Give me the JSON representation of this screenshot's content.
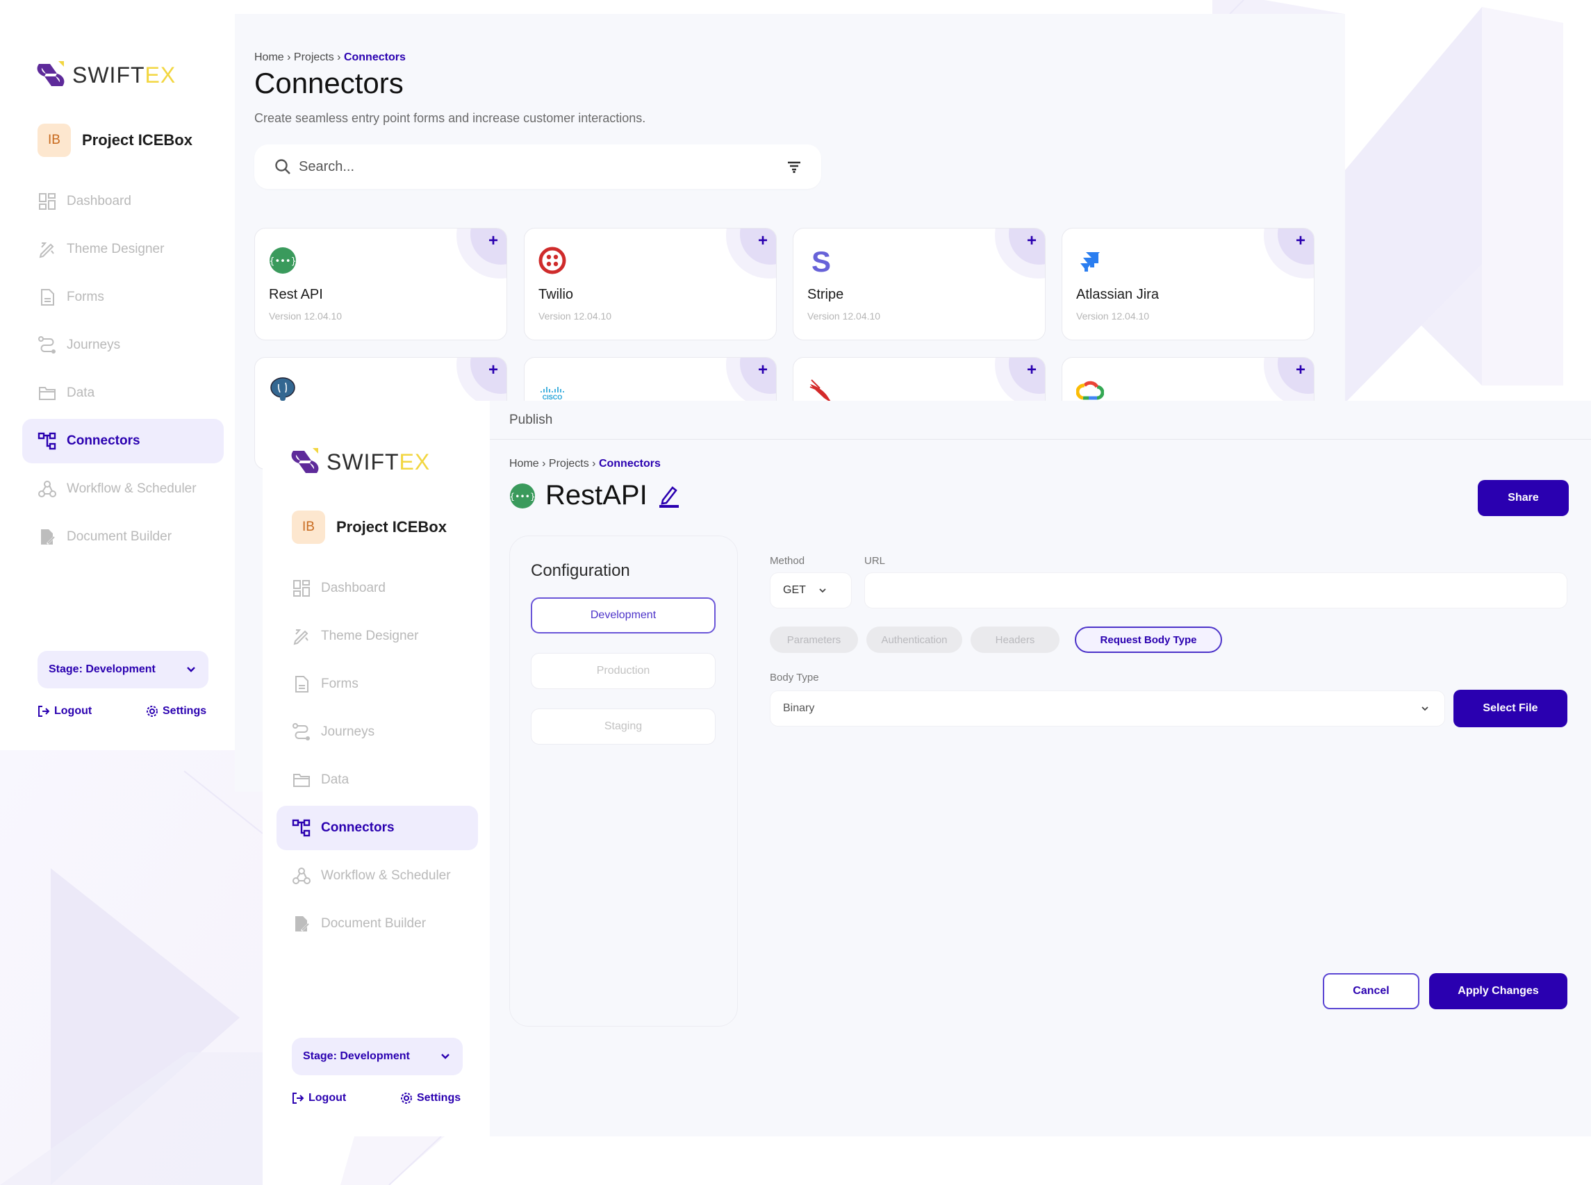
{
  "brand": {
    "name_main": "SWIFT",
    "name_accent": "EX",
    "accent_color": "#f2d640",
    "primary_color": "#2a00b0"
  },
  "project": {
    "initials": "IB",
    "name": "Project ICEBox"
  },
  "sidebar": {
    "items": [
      {
        "label": "Dashboard",
        "icon": "dashboard-icon",
        "active": false
      },
      {
        "label": "Theme Designer",
        "icon": "theme-designer-icon",
        "active": false
      },
      {
        "label": "Forms",
        "icon": "forms-icon",
        "active": false
      },
      {
        "label": "Journeys",
        "icon": "journeys-icon",
        "active": false
      },
      {
        "label": "Data",
        "icon": "folder-icon",
        "active": false
      },
      {
        "label": "Connectors",
        "icon": "connectors-icon",
        "active": true
      },
      {
        "label": "Workflow & Scheduler",
        "icon": "webhook-icon",
        "active": false
      },
      {
        "label": "Document Builder",
        "icon": "document-builder-icon",
        "active": false
      }
    ],
    "stage_label": "Stage: Development",
    "logout_label": "Logout",
    "settings_label": "Settings"
  },
  "back": {
    "breadcrumb": {
      "home": "Home",
      "projects": "Projects",
      "current": "Connectors",
      "separator": "›"
    },
    "title": "Connectors",
    "subtitle": "Create seamless entry point forms and increase customer interactions.",
    "search_placeholder": "Search...",
    "cards": [
      {
        "name": "Rest API",
        "version": "Version 12.04.10",
        "icon": "rest-api-icon"
      },
      {
        "name": "Twilio",
        "version": "Version 12.04.10",
        "icon": "twilio-icon"
      },
      {
        "name": "Stripe",
        "version": "Version 12.04.10",
        "icon": "stripe-icon"
      },
      {
        "name": "Atlassian Jira",
        "version": "Version 12.04.10",
        "icon": "jira-icon"
      },
      {
        "name": "",
        "version": "",
        "icon": "postgresql-icon"
      },
      {
        "name": "",
        "version": "",
        "icon": "cisco-icon"
      },
      {
        "name": "",
        "version": "",
        "icon": "crowdstrike-icon"
      },
      {
        "name": "",
        "version": "",
        "icon": "google-cloud-icon"
      }
    ],
    "add_symbol": "+"
  },
  "front": {
    "publish_label": "Publish",
    "breadcrumb": {
      "home": "Home",
      "projects": "Projects",
      "current": "Connectors",
      "separator": "›"
    },
    "title": "RestAPI",
    "share_label": "Share",
    "configuration": {
      "title": "Configuration",
      "environments": [
        {
          "label": "Development",
          "active": true
        },
        {
          "label": "Production",
          "active": false
        },
        {
          "label": "Staging",
          "active": false
        }
      ]
    },
    "method_label": "Method",
    "method_value": "GET",
    "url_label": "URL",
    "url_value": "",
    "tabs": [
      {
        "label": "Parameters",
        "active": false
      },
      {
        "label": "Authentication",
        "active": false
      },
      {
        "label": "Headers",
        "active": false
      },
      {
        "label": "Request Body Type",
        "active": true
      }
    ],
    "body_type_label": "Body Type",
    "body_type_value": "Binary",
    "select_file_label": "Select File",
    "cancel_label": "Cancel",
    "apply_label": "Apply Changes"
  }
}
